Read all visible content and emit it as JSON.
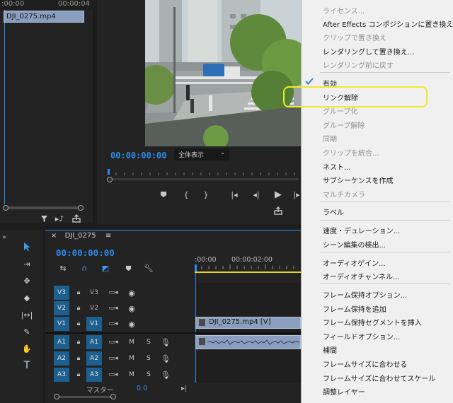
{
  "source": {
    "ruler_left": ":00:00",
    "ruler_right": "00:00:04",
    "clip_name": "DJI_0275.mp4"
  },
  "program": {
    "timecode": "00:00:00:00",
    "zoom": "全体表示"
  },
  "timeline": {
    "tab": "DJI_0275",
    "timecode": "00:00:00:00",
    "ruler": [
      ":00:00",
      "00:00:02:00"
    ],
    "tracks": [
      {
        "id": "V3",
        "target": "V3"
      },
      {
        "id": "V2",
        "target": "V2"
      },
      {
        "id": "V1",
        "target": "V1"
      },
      {
        "id": "A1",
        "target": "A1"
      },
      {
        "id": "A2",
        "target": "A2"
      },
      {
        "id": "A3",
        "target": "A3"
      }
    ],
    "clip_v1": "DJI_0275.mp4 [V]",
    "master_label": "マスター",
    "master_value": "0.0",
    "m_label": "M",
    "s_label": "S"
  },
  "menu": {
    "items": [
      {
        "label": "ライセンス...",
        "disabled": true
      },
      {
        "label": "After Effects コンポジションに置き換え",
        "disabled": false
      },
      {
        "label": "クリップで置き換え",
        "disabled": true
      },
      {
        "label": "レンダリングして置き換え...",
        "disabled": false
      },
      {
        "label": "レンダリング前に戻す",
        "disabled": true
      },
      {
        "label": "有効",
        "disabled": false
      },
      {
        "label": "リンク解除",
        "disabled": false
      },
      {
        "label": "グループ化",
        "disabled": true
      },
      {
        "label": "グループ解除",
        "disabled": true
      },
      {
        "label": "同期",
        "disabled": true
      },
      {
        "label": "クリップを統合...",
        "disabled": true
      },
      {
        "label": "ネスト...",
        "disabled": false
      },
      {
        "label": "サブシーケンスを作成",
        "disabled": false
      },
      {
        "label": "マルチカメラ",
        "disabled": true
      },
      {
        "label": "ラベル",
        "disabled": false
      },
      {
        "label": "速度・デュレーション...",
        "disabled": false
      },
      {
        "label": "シーン編集の検出...",
        "disabled": false
      },
      {
        "label": "オーディオゲイン...",
        "disabled": false
      },
      {
        "label": "オーディオチャンネル...",
        "disabled": false
      },
      {
        "label": "フレーム保持オプション...",
        "disabled": false
      },
      {
        "label": "フレーム保持を追加",
        "disabled": false
      },
      {
        "label": "フレーム保持セグメントを挿入",
        "disabled": false
      },
      {
        "label": "フィールドオプション...",
        "disabled": false
      },
      {
        "label": "補間",
        "disabled": false
      },
      {
        "label": "フレームサイズに合わせる",
        "disabled": false
      },
      {
        "label": "フレームサイズに合わせてスケール",
        "disabled": false
      },
      {
        "label": "調整レイヤー",
        "disabled": false
      }
    ]
  },
  "colors": {
    "accent": "#2d8ceb",
    "clip": "#8a9fbf",
    "track_on": "#1d5f8f",
    "highlight": "#ecec2a"
  }
}
